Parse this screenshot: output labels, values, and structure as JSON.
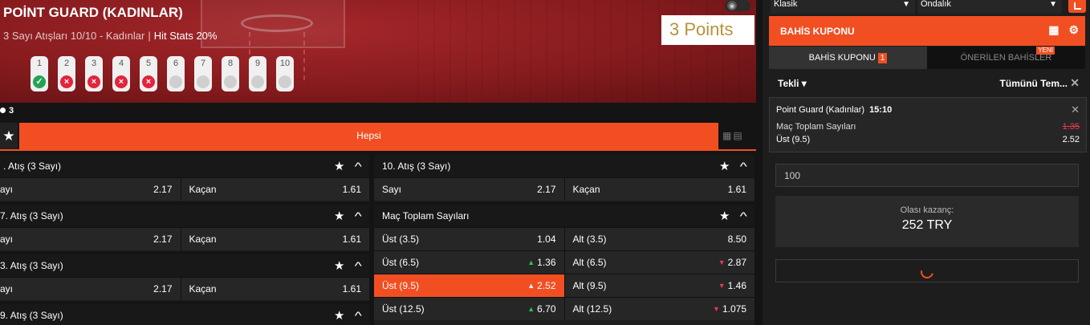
{
  "hero": {
    "title": "POİNT GUARD (KADINLAR)",
    "subtitle": "3 Sayı Atışları 10/10 - Kadınlar",
    "separator": "|",
    "stats": "Hit Stats 20%",
    "points_label": "3 Points",
    "toggle_icon": "compass-icon",
    "shots": [
      {
        "n": "1",
        "status": "hit"
      },
      {
        "n": "2",
        "status": "miss"
      },
      {
        "n": "3",
        "status": "miss"
      },
      {
        "n": "4",
        "status": "miss"
      },
      {
        "n": "5",
        "status": "miss"
      },
      {
        "n": "6",
        "status": "pending"
      },
      {
        "n": "7",
        "status": "pending"
      },
      {
        "n": "8",
        "status": "pending"
      },
      {
        "n": "9",
        "status": "pending"
      },
      {
        "n": "10",
        "status": "pending"
      }
    ],
    "counter": "3"
  },
  "filter": {
    "all_label": "Hepsi"
  },
  "markets": {
    "m1": {
      "title": ". Atış (3 Sayı)",
      "rows": [
        [
          {
            "label": "ayı",
            "odd": "2.17"
          },
          {
            "label": "Kaçan",
            "odd": "1.61"
          }
        ]
      ]
    },
    "m2": {
      "title": "7. Atış (3 Sayı)",
      "rows": [
        [
          {
            "label": "ayı",
            "odd": "2.17"
          },
          {
            "label": "Kaçan",
            "odd": "1.61"
          }
        ]
      ]
    },
    "m3": {
      "title": "3. Atış (3 Sayı)",
      "rows": [
        [
          {
            "label": "ayı",
            "odd": "2.17"
          },
          {
            "label": "Kaçan",
            "odd": "1.61"
          }
        ]
      ]
    },
    "m4": {
      "title": "9. Atış (3 Sayı)"
    },
    "m5": {
      "title": "10. Atış (3 Sayı)",
      "rows": [
        [
          {
            "label": "Sayı",
            "odd": "2.17"
          },
          {
            "label": "Kaçan",
            "odd": "1.61"
          }
        ]
      ]
    },
    "m6": {
      "title": "Maç Toplam Sayıları",
      "rows": [
        [
          {
            "label": "Üst (3.5)",
            "odd": "1.04",
            "trend": ""
          },
          {
            "label": "Alt (3.5)",
            "odd": "8.50",
            "trend": ""
          }
        ],
        [
          {
            "label": "Üst (6.5)",
            "odd": "1.36",
            "trend": "up"
          },
          {
            "label": "Alt (6.5)",
            "odd": "2.87",
            "trend": "down"
          }
        ],
        [
          {
            "label": "Üst (9.5)",
            "odd": "2.52",
            "trend": "up",
            "selected": true
          },
          {
            "label": "Alt (9.5)",
            "odd": "1.46",
            "trend": "down"
          }
        ],
        [
          {
            "label": "Üst (12.5)",
            "odd": "6.70",
            "trend": "up"
          },
          {
            "label": "Alt (12.5)",
            "odd": "1.075",
            "trend": "down"
          }
        ]
      ]
    }
  },
  "panel": {
    "select1": "Klasik",
    "select2": "Ondalık",
    "coupon_title": "BAHİS KUPONU",
    "tab_coupon": "BAHİS KUPONU",
    "tab_coupon_count": "1",
    "tab_suggested": "ÖNERİLEN BAHİSLER",
    "new_badge": "YENİ",
    "single_label": "Tekli ▾",
    "clear_all": "Tümünü Tem...",
    "slip": {
      "event": "Point Guard (Kadınlar)",
      "time": "15:10",
      "market": "Maç Toplam Sayıları",
      "old_odd": "1.35",
      "pick": "Üst (9.5)",
      "odd": "2.52"
    },
    "stake": "100",
    "win_label": "Olası kazanç:",
    "win_amount": "252 TRY"
  },
  "colors": {
    "accent": "#f14f22",
    "up": "#28c45c",
    "down": "#e23b4e"
  }
}
